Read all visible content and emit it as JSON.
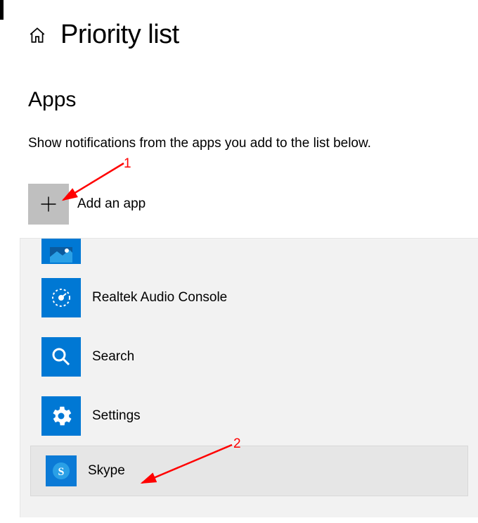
{
  "header": {
    "title": "Priority list"
  },
  "section": {
    "heading": "Apps",
    "description": "Show notifications from the apps you add to the list below."
  },
  "add": {
    "label": "Add an app"
  },
  "apps": {
    "partial": "",
    "realtek": "Realtek Audio Console",
    "search": "Search",
    "settings": "Settings",
    "skype": "Skype"
  },
  "annotations": {
    "one": "1",
    "two": "2"
  }
}
